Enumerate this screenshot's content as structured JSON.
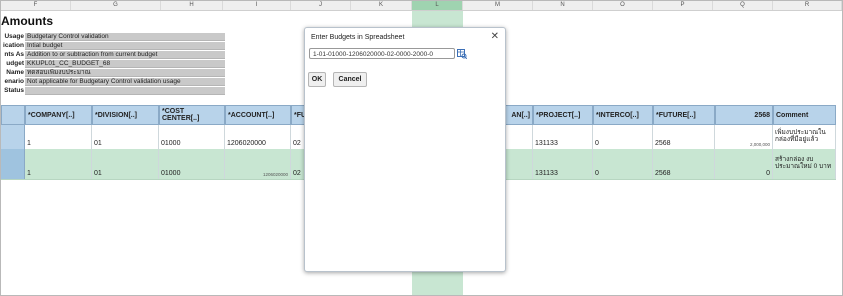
{
  "column_letters": [
    "F",
    "G",
    "H",
    "I",
    "J",
    "K",
    "L",
    "M",
    "N",
    "O",
    "P",
    "Q",
    "R"
  ],
  "sheet_title": "Amounts",
  "info_rows": [
    {
      "label": "Usage",
      "value": "Budgetary Control validation"
    },
    {
      "label": "ication",
      "value": "Intial budget"
    },
    {
      "label": "nts As",
      "value": "Addition to or subtraction from current budget"
    },
    {
      "label": "udget",
      "value": "KKUPL01_CC_BUDGET_68"
    },
    {
      "label": "Name",
      "value": "ทดสอบเพิ่มงบประมาณ"
    },
    {
      "label": "enario",
      "value": "Not applicable for Budgetary Control validation usage"
    },
    {
      "label": "Status",
      "value": ""
    }
  ],
  "headers": {
    "company": "*COMPANY[..]",
    "division": "*DIVISION[..]",
    "cost_center": "*COST CENTER[..]",
    "account": "*ACCOUNT[..]",
    "fu": "*FU",
    "an": "AN[..]",
    "project": "*PROJECT[..]",
    "interco": "*INTERCO[..]",
    "future": "*FUTURE[..]",
    "year": "2568",
    "comment": "Comment"
  },
  "rows": [
    {
      "company": "1",
      "division": "01",
      "cost_center": "01000",
      "account": "1206020000",
      "fu": "02",
      "project": "131133",
      "interco": "0",
      "future": "2568",
      "amount": "2,000,000",
      "comment": "เพิ่มงบประมาณใน กล่องที่มีอยู่แล้ว"
    },
    {
      "company": "1",
      "division": "01",
      "cost_center": "01000",
      "account": "",
      "account_small": "1206020000",
      "fu": "02",
      "project": "131133",
      "interco": "0",
      "future": "2568",
      "amount": "0",
      "comment": "สร้างกล่อง งบประมาณใหม่ 0 บาท"
    }
  ],
  "dialog": {
    "title": "Enter Budgets in Spreadsheet",
    "input_value": "1-01-01000-1206020000-02-0000-2000-0",
    "ok_label": "OK",
    "cancel_label": "Cancel"
  },
  "colors": {
    "header_blue": "#b8d3ea",
    "selected_green": "#c8e6d2",
    "info_gray": "#c9c9c9"
  }
}
